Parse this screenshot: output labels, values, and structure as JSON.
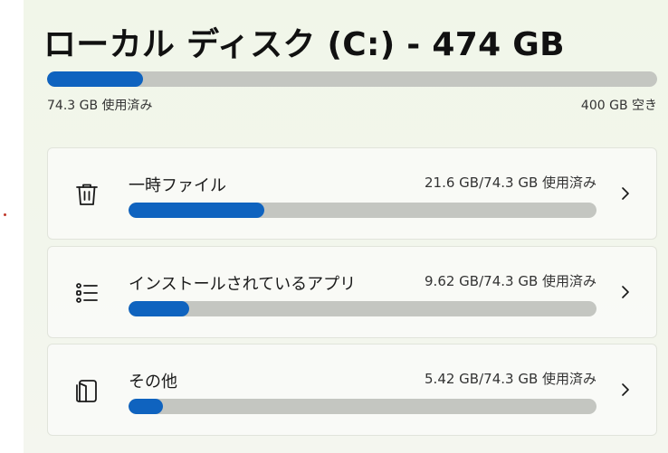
{
  "disk": {
    "title": "ローカル ディスク (C:) - 474 GB",
    "used_label": "74.3 GB 使用済み",
    "free_label": "400 GB 空き",
    "used_fraction": 0.157
  },
  "categories": [
    {
      "label": "一時ファイル",
      "usage": "21.6 GB/74.3 GB 使用済み",
      "fraction": 0.291,
      "icon": "trash-icon"
    },
    {
      "label": "インストールされているアプリ",
      "usage": "9.62 GB/74.3 GB 使用済み",
      "fraction": 0.129,
      "icon": "list-icon"
    },
    {
      "label": "その他",
      "usage": "5.42 GB/74.3 GB 使用済み",
      "fraction": 0.073,
      "icon": "folder-icon"
    }
  ],
  "colors": {
    "accent": "#0f63bf",
    "track": "#c4c6c1"
  }
}
